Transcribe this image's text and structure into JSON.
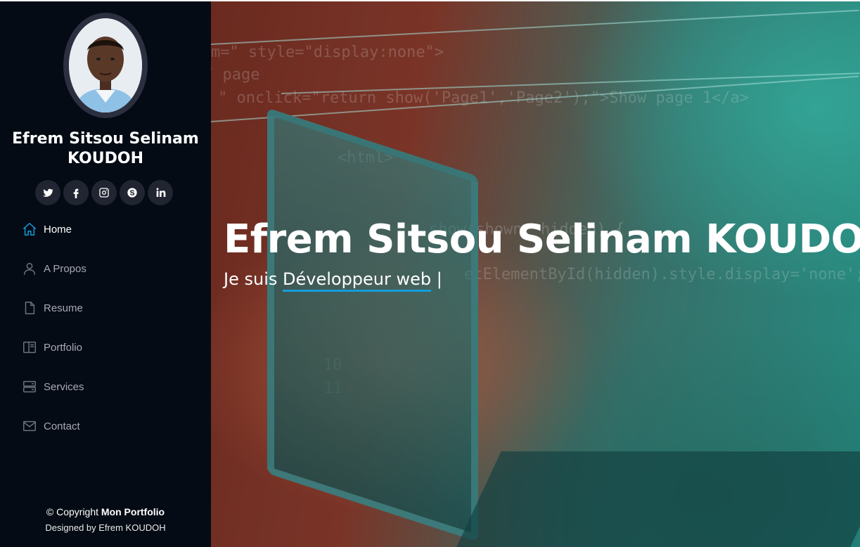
{
  "profile": {
    "name": "Efrem Sitsou Selinam KOUDOH"
  },
  "social": [
    "twitter-icon",
    "facebook-icon",
    "instagram-icon",
    "skype-icon",
    "linkedin-icon"
  ],
  "nav": {
    "items": [
      {
        "label": "Home",
        "icon": "home-icon",
        "active": true
      },
      {
        "label": "A Propos",
        "icon": "user-icon"
      },
      {
        "label": "Resume",
        "icon": "file-icon"
      },
      {
        "label": "Portfolio",
        "icon": "portfolio-icon"
      },
      {
        "label": "Services",
        "icon": "server-icon"
      },
      {
        "label": "Contact",
        "icon": "envelope-icon"
      }
    ]
  },
  "footer": {
    "copyright_prefix": "© Copyright",
    "copyright_brand": "Mon Portfolio",
    "designed_by": "Designed by Efrem KOUDOH"
  },
  "hero": {
    "title": "Efrem Sitsou Selinam KOUDOH",
    "subtitle_prefix": "Je suis",
    "typed_text": "Développeur web",
    "cursor": "|"
  },
  "colors": {
    "sidebar_bg": "#040b14",
    "accent": "#149ddd",
    "social_bg": "#212431"
  }
}
